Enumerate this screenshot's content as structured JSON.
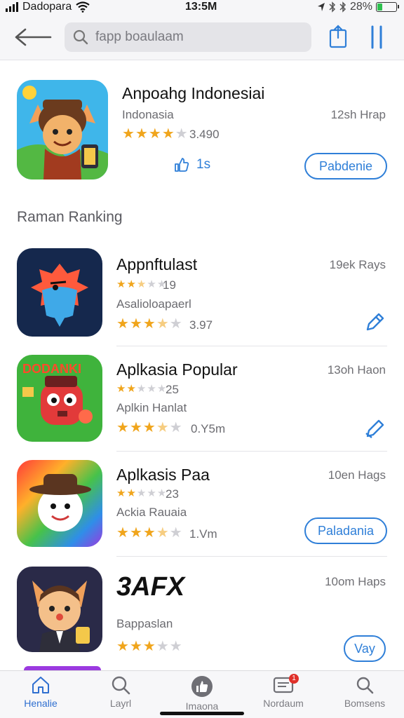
{
  "status_bar": {
    "carrier": "Dadopara",
    "time": "13:5M",
    "battery": "28%",
    "battery_level": 0.28
  },
  "search": {
    "placeholder": "fapp boaulaam"
  },
  "featured": {
    "title": "Anpoahg Indonesiai",
    "subtitle": "Indonasia",
    "meta": "12sh Hrap",
    "rating_value": "3.490",
    "rating_stars": 4,
    "like_count": "1s",
    "action_label": "Pabdenie"
  },
  "section": {
    "title": "Raman Ranking"
  },
  "rankings": [
    {
      "title": "Appnftulast",
      "meta": "19ek Rays",
      "small_rating": "19",
      "small_stars": 2.5,
      "subtitle": "Asalioloapaerl",
      "rating_value": "3.97",
      "rating_stars": 3.5,
      "action": "edit"
    },
    {
      "title": "Aplkasia Popular",
      "meta": "13oh Haon",
      "small_rating": "25",
      "small_stars": 2,
      "subtitle": "Aplkin Hanlat",
      "rating_value": "0.Y5m",
      "rating_stars": 3.5,
      "action": "edit"
    },
    {
      "title": "Aplkasis Paa",
      "meta": "10en Hags",
      "small_rating": "23",
      "small_stars": 2,
      "subtitle": "Ackia Rauaia",
      "rating_value": "1.Vm",
      "rating_stars": 3.5,
      "action": "Paladania"
    },
    {
      "title": "3AFX",
      "meta": "10om Haps",
      "subtitle": "Bappaslan",
      "rating_stars": 3,
      "action": "Vay"
    }
  ],
  "icon_art": {
    "row1": "DODANKI"
  },
  "tabbar": {
    "items": [
      {
        "label": "Henalie",
        "icon": "home-icon"
      },
      {
        "label": "Layrl",
        "icon": "search-icon"
      },
      {
        "label": "Imaona",
        "icon": "thumbs-up-icon"
      },
      {
        "label": "Nordaum",
        "icon": "notifications-icon",
        "badge": "1"
      },
      {
        "label": "Bomsens",
        "icon": "search-icon"
      }
    ]
  }
}
